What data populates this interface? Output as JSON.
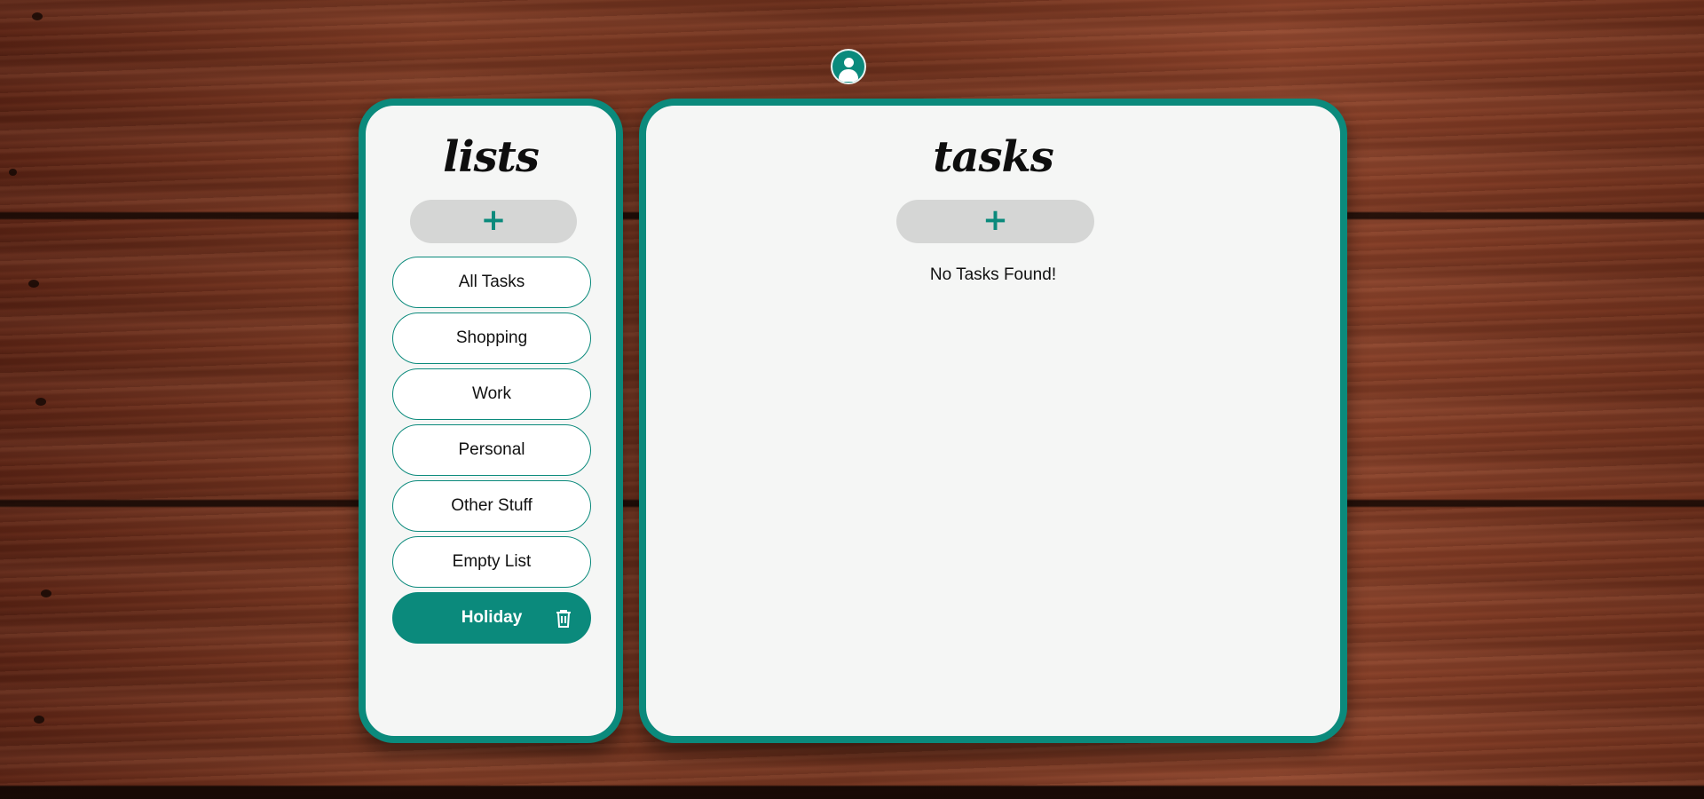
{
  "header": {
    "avatar_icon": "user-avatar-icon"
  },
  "lists_panel": {
    "title": "lists",
    "add_label": "+",
    "items": [
      {
        "label": "All Tasks",
        "active": false
      },
      {
        "label": "Shopping",
        "active": false
      },
      {
        "label": "Work",
        "active": false
      },
      {
        "label": "Personal",
        "active": false
      },
      {
        "label": "Other Stuff",
        "active": false
      },
      {
        "label": "Empty List",
        "active": false
      },
      {
        "label": "Holiday",
        "active": true,
        "action_icon": "trash-icon"
      }
    ]
  },
  "tasks_panel": {
    "title": "tasks",
    "add_label": "+",
    "empty_message": "No Tasks Found!"
  },
  "colors": {
    "accent": "#0b8a7c",
    "panel_bg": "#f5f6f5",
    "add_button_bg": "#d5d6d5"
  }
}
